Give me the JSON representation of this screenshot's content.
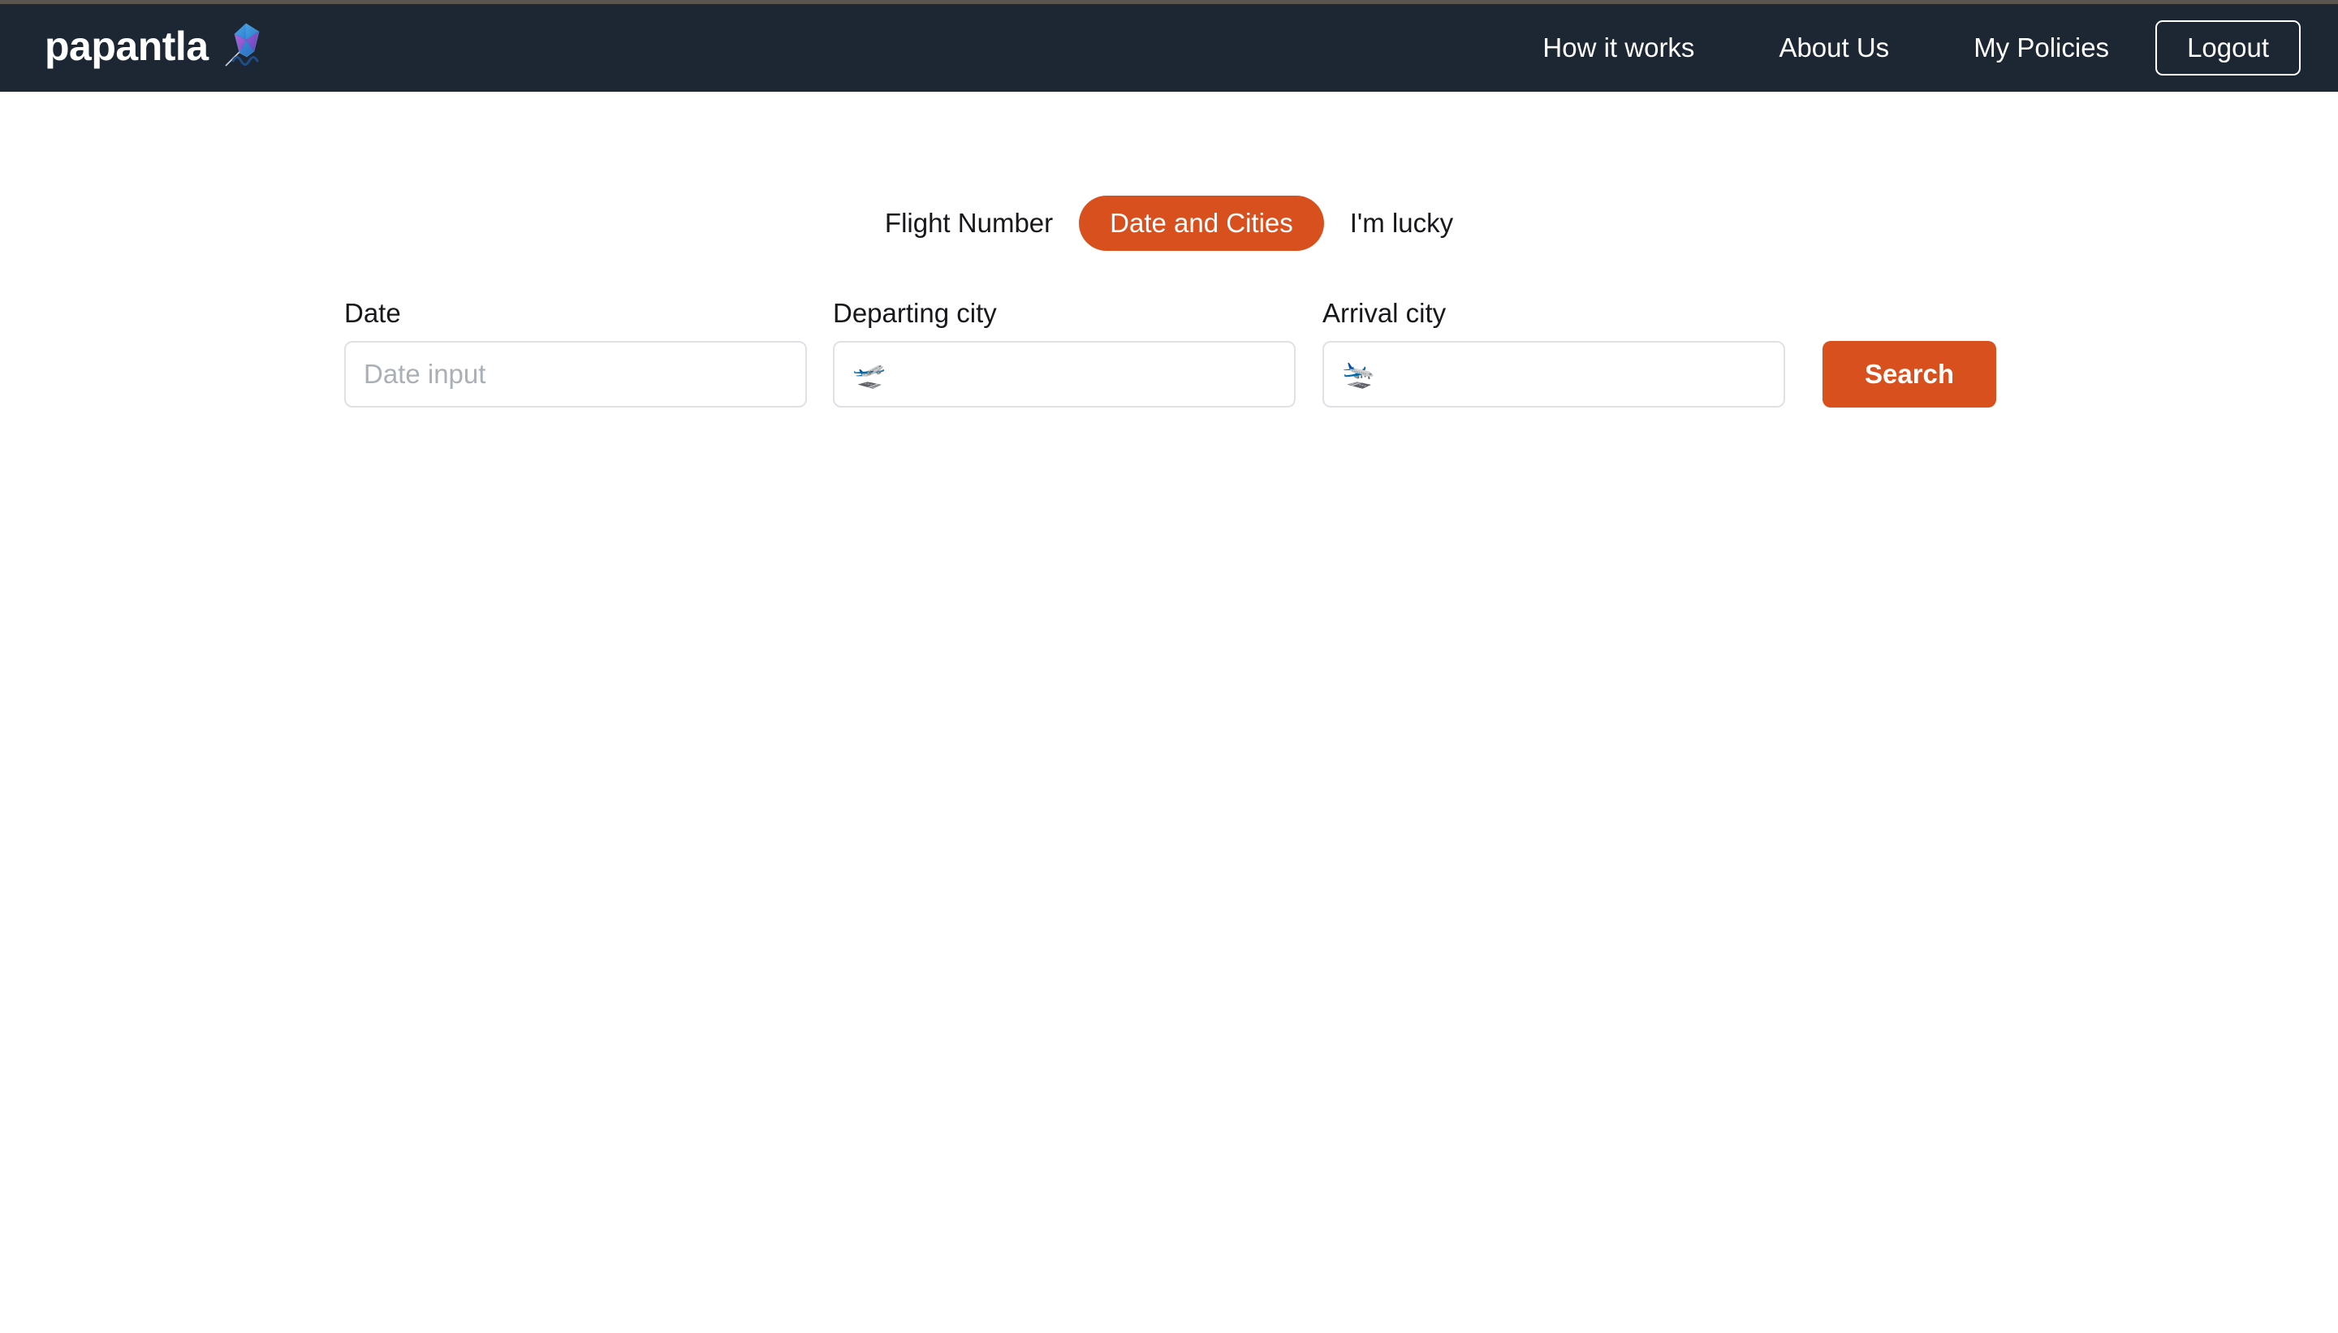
{
  "header": {
    "brand_name": "papantla",
    "brand_icon": "kite-icon",
    "nav_items": [
      {
        "label": "How it works"
      },
      {
        "label": "About Us"
      },
      {
        "label": "My Policies"
      }
    ],
    "logout_label": "Logout",
    "background_color": "#1c2733"
  },
  "tabs": [
    {
      "label": "Flight Number",
      "active": false
    },
    {
      "label": "Date and Cities",
      "active": true
    },
    {
      "label": "I'm lucky",
      "active": false
    }
  ],
  "form": {
    "date": {
      "label": "Date",
      "placeholder": "Date input",
      "value": ""
    },
    "departing_city": {
      "label": "Departing city",
      "placeholder": "🛫",
      "placeholder_icon": "airplane-departure-icon",
      "value": ""
    },
    "arrival_city": {
      "label": "Arrival city",
      "placeholder": "🛬",
      "placeholder_icon": "airplane-arrival-icon",
      "value": ""
    },
    "search_label": "Search"
  },
  "colors": {
    "accent_orange": "#d9501f",
    "header_navy": "#1c2733",
    "input_border": "#dee2e6",
    "placeholder_gray": "#a9b0b7",
    "page_background": "#ffffff"
  }
}
